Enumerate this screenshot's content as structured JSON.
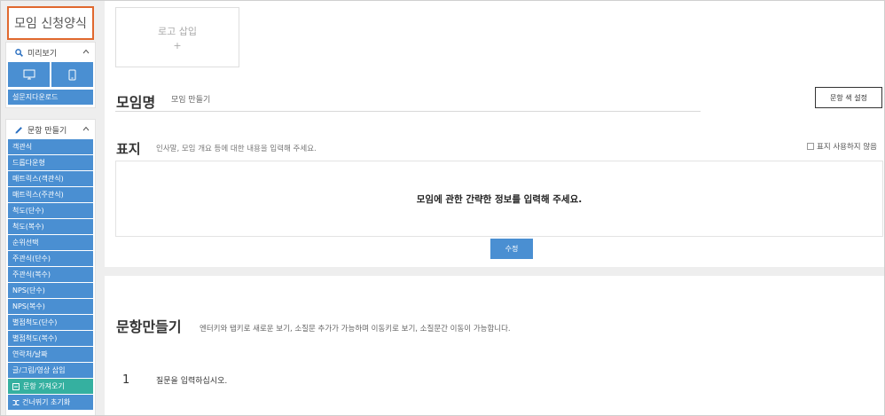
{
  "app_title": "모임 신청양식",
  "preview": {
    "label": "미리보기",
    "download_label": "설문지다운로드"
  },
  "question_builder": {
    "label": "문항 만들기",
    "items": [
      "객관식",
      "드롭다운형",
      "매트릭스(객관식)",
      "매트릭스(주관식)",
      "척도(단수)",
      "척도(복수)",
      "순위선택",
      "주관식(단수)",
      "주관식(복수)",
      "NPS(단수)",
      "NPS(복수)",
      "별점척도(단수)",
      "별점척도(복수)",
      "연락처/날짜",
      "글/그림/영상 삽입"
    ],
    "import_label": "문항 가져오기",
    "partial_label": "건너뛰기 초기화"
  },
  "logo": {
    "label": "로고 삽입",
    "plus": "+"
  },
  "survey_title": {
    "label": "모임명",
    "value": "모임 만들기"
  },
  "color_button": "문항 색 설정",
  "cover": {
    "label": "표지",
    "hint": "인사말, 모임 개요 등에 대한 내용을 입력해 주세요.",
    "no_cover_label": "표지 사용하지 않음",
    "body": "모임에 관한 간략한 정보를 입력해 주세요.",
    "edit_button": "수정"
  },
  "questions": {
    "label": "문항만들기",
    "hint": "엔터키와 탭키로 새로운 보기, 소질문 추가가 가능하며 이동키로 보기, 소질문간 이동이 가능합니다.",
    "first_number": "1",
    "first_placeholder": "질문을 입력하십시오."
  },
  "colors": {
    "accent_blue": "#4a8fd2",
    "accent_green": "#35b0a0",
    "title_border": "#e0682e"
  }
}
